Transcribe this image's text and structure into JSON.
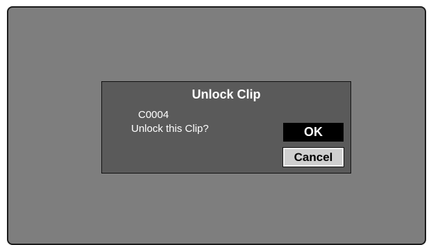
{
  "dialog": {
    "title": "Unlock Clip",
    "clip_id": "C0004",
    "message": "Unlock this Clip?",
    "ok_label": "OK",
    "cancel_label": "Cancel"
  },
  "colors": {
    "screen_background": "#7e7e7e",
    "dialog_background": "#5a5a5a",
    "ok_button_background": "#000000",
    "cancel_button_background": "#cfcfcf",
    "text": "#ffffff"
  }
}
